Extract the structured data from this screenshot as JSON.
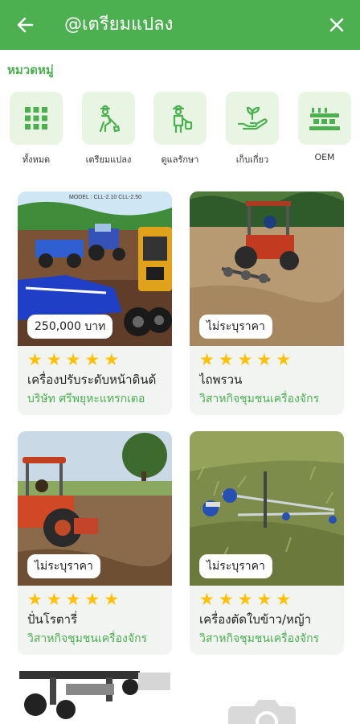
{
  "appbar": {
    "title": "@เตรียมแปลง",
    "back_icon": "arrow-left-icon",
    "close_icon": "close-icon",
    "color": "#4caf50"
  },
  "section": {
    "title": "หมวดหมู่"
  },
  "categories": [
    {
      "label": "ทั้งหมด",
      "icon": "grid-icon"
    },
    {
      "label": "เตรียมแปลง",
      "icon": "farmer-digging-icon"
    },
    {
      "label": "ดูแลรักษา",
      "icon": "farmer-watering-icon"
    },
    {
      "label": "เก็บเกี่ยว",
      "icon": "hand-plant-icon"
    },
    {
      "label": "OEM",
      "icon": "factory-icon"
    }
  ],
  "products": [
    {
      "price": "250,000 บาท",
      "rating": 5,
      "name": "เครื่องปรับระดับหน้าดินด้",
      "shop": "บริษัท ศรีพยุหะแทรกเตอ",
      "model_text": "MODEL : CLL-2.10 CLL-2.50"
    },
    {
      "price": "ไม่ระบุราคา",
      "rating": 5,
      "name": "ไถพรวน",
      "shop": "วิสาหกิจชุมชนเครื่องจักร"
    },
    {
      "price": "ไม่ระบุราคา",
      "rating": 5,
      "name": "ปั่นโรตารี่",
      "shop": "วิสาหกิจชุมชนเครื่องจักร"
    },
    {
      "price": "ไม่ระบุราคา",
      "rating": 5,
      "name": "เครื่องตัดใบข้าว/หญ้า",
      "shop": "วิสาหกิจชุมชนเครื่องจักร"
    }
  ],
  "colors": {
    "accent": "#4caf50",
    "tile_bg": "#e8f5e3",
    "card_bg": "#f1f4f1",
    "star": "#ffc107"
  }
}
